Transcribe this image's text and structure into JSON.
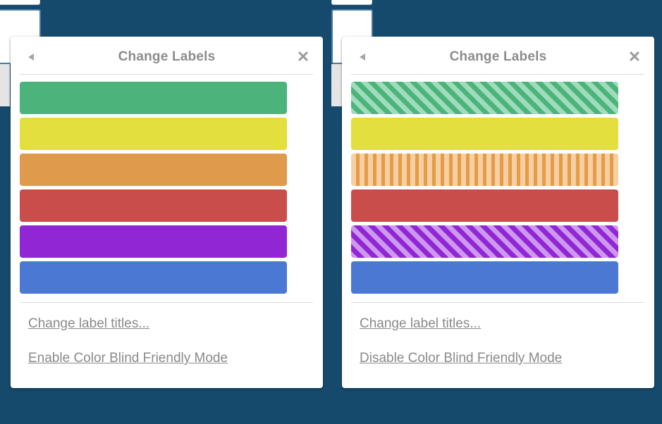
{
  "panels": [
    {
      "title": "Change Labels",
      "back_icon": "back-arrow-icon",
      "close_icon": "close-x-icon",
      "color_blind_mode": false,
      "labels": [
        {
          "color": "green",
          "base": "#4cb47a",
          "pattern": "solid"
        },
        {
          "color": "yellow",
          "base": "#e2df3e",
          "pattern": "solid"
        },
        {
          "color": "orange",
          "base": "#df9a4c",
          "pattern": "solid"
        },
        {
          "color": "red",
          "base": "#c94e4b",
          "pattern": "solid"
        },
        {
          "color": "purple",
          "base": "#9127d4",
          "pattern": "solid"
        },
        {
          "color": "blue",
          "base": "#4a78d3",
          "pattern": "solid"
        }
      ],
      "links": {
        "change_titles": "Change label titles...",
        "toggle_mode": "Enable Color Blind Friendly Mode"
      }
    },
    {
      "title": "Change Labels",
      "back_icon": "back-arrow-icon",
      "close_icon": "close-x-icon",
      "color_blind_mode": true,
      "labels": [
        {
          "color": "green",
          "base": "#4cb47a",
          "alt": "#9fdcbc",
          "pattern": "diagonal-stripes"
        },
        {
          "color": "yellow",
          "base": "#e2df3e",
          "pattern": "solid"
        },
        {
          "color": "orange",
          "base": "#e59c46",
          "alt": "#f6cfa3",
          "pattern": "vertical-stripes"
        },
        {
          "color": "red",
          "base": "#c94e4b",
          "pattern": "solid"
        },
        {
          "color": "purple",
          "base": "#9127d4",
          "alt": "#cd98ee",
          "pattern": "diagonal-stripes"
        },
        {
          "color": "blue",
          "base": "#4a78d3",
          "pattern": "solid"
        }
      ],
      "links": {
        "change_titles": "Change label titles...",
        "toggle_mode": "Disable Color Blind Friendly Mode"
      }
    }
  ],
  "colors": {
    "background": "#164a6d",
    "title": "#8c8c8c",
    "link": "#8a8a8a"
  }
}
